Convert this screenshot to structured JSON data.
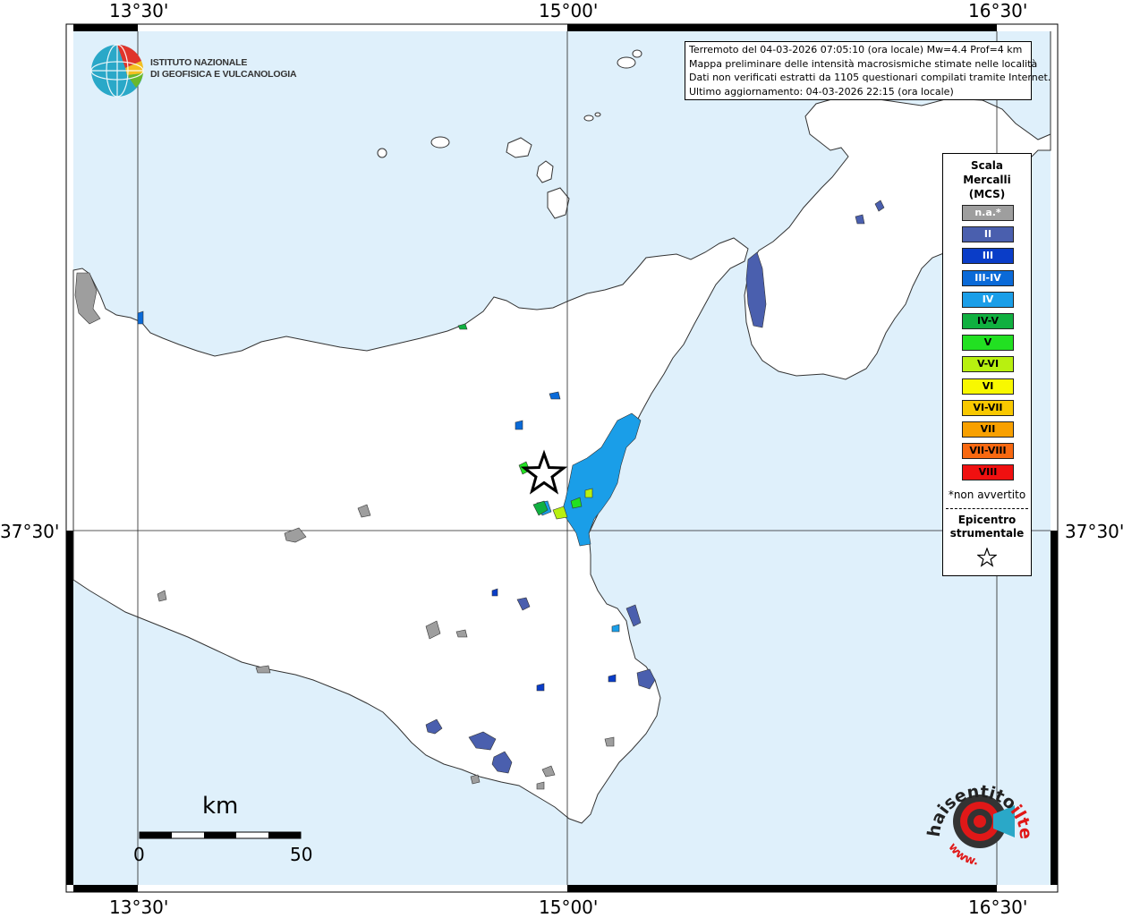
{
  "map": {
    "coords": {
      "top_left": "13°30'",
      "top_mid": "15°00'",
      "top_right": "16°30'",
      "bottom_left": "13°30'",
      "bottom_mid": "15°00'",
      "bottom_right": "16°30'",
      "left_lat": "37°30'",
      "right_lat": "37°30'"
    },
    "colors": {
      "sea": "#dff0fb",
      "land": "#ffffff"
    }
  },
  "info": {
    "line1": "Terremoto del 04-03-2026 07:05:10 (ora locale) Mw=4.4 Prof=4 km",
    "line2": "Mappa preliminare delle intensità macrosismiche stimate nelle località",
    "line3": "Dati non verificati estratti da 1105 questionari compilati tramite Internet.",
    "line4": "Ultimo aggiornamento: 04-03-2026 22:15 (ora locale)"
  },
  "legend": {
    "title_line1": "Scala",
    "title_line2": "Mercalli",
    "title_line3": "(MCS)",
    "items": [
      {
        "label": "n.a.*",
        "color": "#9e9e9e"
      },
      {
        "label": "II",
        "color": "#4a5fae"
      },
      {
        "label": "III",
        "color": "#0a3dc8"
      },
      {
        "label": "III-IV",
        "color": "#0a6ad8"
      },
      {
        "label": "IV",
        "color": "#1a9ee8"
      },
      {
        "label": "IV-V",
        "color": "#10b040"
      },
      {
        "label": "V",
        "color": "#22e022"
      },
      {
        "label": "V-VI",
        "color": "#b8f010"
      },
      {
        "label": "VI",
        "color": "#f8f800"
      },
      {
        "label": "VI-VII",
        "color": "#f8c800"
      },
      {
        "label": "VII",
        "color": "#f8a000"
      },
      {
        "label": "VII-VIII",
        "color": "#f86810"
      },
      {
        "label": "VIII",
        "color": "#f01010"
      }
    ],
    "note": "*non avvertito",
    "epicenter_line1": "Epicentro",
    "epicenter_line2": "strumentale"
  },
  "logo": {
    "line1": "ISTITUTO NAZIONALE",
    "line2": "DI GEOFISICA E VULCANOLOGIA"
  },
  "scale_bar": {
    "unit": "km",
    "min_label": "0",
    "max_label": "50"
  },
  "website_logo": {
    "text_dark": "haisentito",
    "text_red": "ilterremoto.it",
    "prefix": "www."
  }
}
